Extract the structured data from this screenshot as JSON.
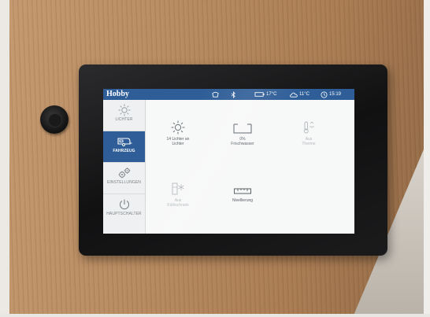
{
  "device": {
    "brand": "Hobby",
    "status": {
      "inside_temp": "17°C",
      "outside_temp": "11°C",
      "time": "15:19",
      "icons": [
        "tank-icon",
        "bluetooth-icon",
        "battery-icon",
        "cloud-icon",
        "clock-icon"
      ]
    },
    "nav": [
      {
        "label": "LICHTER",
        "icon": "sun-icon",
        "active": false
      },
      {
        "label": "FAHRZEUG",
        "icon": "caravan-icon",
        "active": true
      },
      {
        "label": "EINSTELLUNGEN",
        "icon": "gears-icon",
        "active": false
      },
      {
        "label": "HAUPTSCHALTER",
        "icon": "power-icon",
        "active": false
      }
    ],
    "tiles": {
      "lights": {
        "line1": "14 Lichter an",
        "line2": "Lichter",
        "icon": "sun-icon"
      },
      "water": {
        "line1": "0%",
        "line2": "Frischwasser",
        "icon": "water-tank-icon"
      },
      "climate": {
        "line1": "Aus",
        "line2": "Therme",
        "icon": "thermometer-icon"
      },
      "fridge": {
        "line1": "Aus",
        "line2": "Kühlschrank",
        "icon": "fridge-icon"
      },
      "level": {
        "line1": "Nivellierung",
        "icon": "level-icon"
      }
    },
    "colors": {
      "accent": "#2e5d97",
      "screen_bg": "#f7f8f8"
    }
  }
}
